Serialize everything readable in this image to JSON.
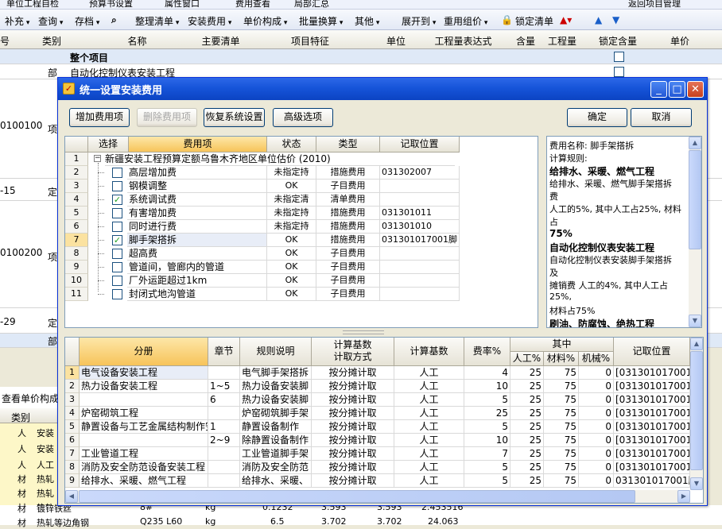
{
  "top_toolbar_1": {
    "items": [
      "单位工程自检",
      "预算书设置",
      "属性窗口",
      "费用查看",
      "局部汇总",
      "返回项目管理"
    ]
  },
  "top_toolbar_2": {
    "items": [
      "补充",
      "查询",
      "存档",
      "整理清单",
      "安装费用",
      "单价构成",
      "批量换算",
      "其他",
      "展开到",
      "重用组价",
      "锁定清单"
    ]
  },
  "bg_sheet": {
    "columns": [
      "号",
      "类别",
      "名称",
      "主要清单",
      "项目特征",
      "单位",
      "工程量表达式",
      "含量",
      "工程量",
      "锁定含量",
      "单价"
    ],
    "rows": [
      {
        "code": "",
        "type": "",
        "name": "整个项目"
      },
      {
        "code": "",
        "type": "部",
        "name": "自动化控制仪表安装工程"
      },
      {
        "code": "0100100",
        "type": "项",
        "name": ""
      },
      {
        "code": "-15",
        "type": "定",
        "name": ""
      },
      {
        "code": "0100200",
        "type": "项",
        "name": ""
      },
      {
        "code": "-29",
        "type": "定",
        "name": ""
      },
      {
        "code": "",
        "type": "部",
        "name": ""
      }
    ],
    "bottom_tab": "查看单价构成",
    "bottom_header": "类别",
    "bottom_rows": [
      {
        "type": "人",
        "name": "安装"
      },
      {
        "type": "人",
        "name": "安装"
      },
      {
        "type": "人",
        "name": "人工"
      },
      {
        "type": "材",
        "name": "热轧"
      },
      {
        "type": "材",
        "name": "热轧"
      },
      {
        "type": "材",
        "name": "热轧"
      },
      {
        "type": "材",
        "name": "镀锌铁丝"
      },
      {
        "type": "材",
        "name": "热轧等边角钢"
      }
    ],
    "bottom_extra": [
      {
        "spec": "8#",
        "unit": "kg",
        "a": "0.1232",
        "b": "3.593",
        "c": "3.593",
        "d": "2.453516"
      },
      {
        "spec": "Q235 L60",
        "unit": "kg",
        "a": "6.5",
        "b": "3.702",
        "c": "3.702",
        "d": "24.063"
      }
    ]
  },
  "dialog": {
    "title": "统一设置安装费用",
    "buttons": {
      "add_fee": "增加费用项",
      "delete_fee": "删除费用项",
      "restore": "恢复系统设置",
      "advanced": "高级选项",
      "ok": "确定",
      "cancel": "取消"
    },
    "upper_grid": {
      "headers": [
        "选择",
        "费用项",
        "状态",
        "类型",
        "记取位置"
      ],
      "rows": [
        {
          "n": "1",
          "name": "新疆安装工程预算定额乌鲁木齐地区单位估价 (2010)",
          "status": "",
          "type": "",
          "pos": "",
          "checked": null
        },
        {
          "n": "2",
          "name": "高层增加费",
          "status": "未指定持",
          "type": "措施费用",
          "pos": "031302007",
          "checked": false
        },
        {
          "n": "3",
          "name": "钢模调整",
          "status": "OK",
          "type": "子目费用",
          "pos": "",
          "checked": false
        },
        {
          "n": "4",
          "name": "系统调试费",
          "status": "未指定清",
          "type": "清单费用",
          "pos": "",
          "checked": true
        },
        {
          "n": "5",
          "name": "有害增加费",
          "status": "未指定持",
          "type": "措施费用",
          "pos": "031301011",
          "checked": false
        },
        {
          "n": "6",
          "name": "同时进行费",
          "status": "未指定持",
          "type": "措施费用",
          "pos": "031301010",
          "checked": false
        },
        {
          "n": "7",
          "name": "脚手架搭拆",
          "status": "OK",
          "type": "措施费用",
          "pos": "031301017001脚",
          "checked": true
        },
        {
          "n": "8",
          "name": "超高费",
          "status": "OK",
          "type": "子目费用",
          "pos": "",
          "checked": false
        },
        {
          "n": "9",
          "name": "管道间，管廊内的管道",
          "status": "OK",
          "type": "子目费用",
          "pos": "",
          "checked": false
        },
        {
          "n": "10",
          "name": "厂外运距超过1km",
          "status": "OK",
          "type": "子目费用",
          "pos": "",
          "checked": false
        },
        {
          "n": "11",
          "name": "封闭式地沟管道",
          "status": "OK",
          "type": "子目费用",
          "pos": "",
          "checked": false
        }
      ]
    },
    "info_lines": [
      {
        "t": "费用名称: 脚手架搭拆",
        "bold": false
      },
      {
        "t": "计算规则:",
        "bold": false
      },
      {
        "t": "给排水、采暖、燃气工程",
        "bold": true
      },
      {
        "t": "给排水、采暖、燃气脚手架搭拆",
        "bold": false
      },
      {
        "t": "费",
        "bold": false
      },
      {
        "t": "人工的5%, 其中人工占25%, 材料",
        "bold": false
      },
      {
        "t": "占",
        "bold": false
      },
      {
        "t": "75%",
        "bold": true
      },
      {
        "t": "自动化控制仪表安装工程",
        "bold": true
      },
      {
        "t": "自动化控制仪表安装脚手架搭拆",
        "bold": false
      },
      {
        "t": "及",
        "bold": false
      },
      {
        "t": "摊销费 人工的4%, 其中人工占",
        "bold": false
      },
      {
        "t": "25%,",
        "bold": false
      },
      {
        "t": "材料占75%",
        "bold": false
      },
      {
        "t": "刷油、防腐蚀、绝热工程",
        "bold": true
      }
    ],
    "lower_grid": {
      "headers": {
        "fenche": "分册",
        "zhangjie": "章节",
        "rule": "规则说明",
        "calc_base_method_1": "计算基数",
        "calc_base_method_2": "计取方式",
        "calc_base": "计算基数",
        "rate": "费率%",
        "of_which": "其中",
        "labor": "人工%",
        "material": "材料%",
        "machine": "机械%",
        "pos": "记取位置"
      },
      "rows": [
        {
          "n": "1",
          "fenche": "电气设备安装工程",
          "zj": "",
          "rule": "电气脚手架搭拆",
          "method": "按分摊计取",
          "base": "人工",
          "rate": "4",
          "labor": "25",
          "mat": "75",
          "mach": "0",
          "pos": "[031301017001脚"
        },
        {
          "n": "2",
          "fenche": "热力设备安装工程",
          "zj": "1~5",
          "rule": "热力设备安装脚",
          "method": "按分摊计取",
          "base": "人工",
          "rate": "10",
          "labor": "25",
          "mat": "75",
          "mach": "0",
          "pos": "[031301017001脚"
        },
        {
          "n": "3",
          "fenche": "",
          "zj": "6",
          "rule": "热力设备安装脚",
          "method": "按分摊计取",
          "base": "人工",
          "rate": "5",
          "labor": "25",
          "mat": "75",
          "mach": "0",
          "pos": "[031301017001脚"
        },
        {
          "n": "4",
          "fenche": "炉窑砌筑工程",
          "zj": "",
          "rule": "炉窑砌筑脚手架",
          "method": "按分摊计取",
          "base": "人工",
          "rate": "25",
          "labor": "25",
          "mat": "75",
          "mach": "0",
          "pos": "[031301017001脚"
        },
        {
          "n": "5",
          "fenche": "静置设备与工艺金属结构制作安装工程",
          "zj": "1",
          "rule": "静置设备制作",
          "method": "按分摊计取",
          "base": "人工",
          "rate": "5",
          "labor": "25",
          "mat": "75",
          "mach": "0",
          "pos": "[031301017001脚"
        },
        {
          "n": "6",
          "fenche": "",
          "zj": "2~9",
          "rule": "除静置设备制作",
          "method": "按分摊计取",
          "base": "人工",
          "rate": "10",
          "labor": "25",
          "mat": "75",
          "mach": "0",
          "pos": "[031301017001脚"
        },
        {
          "n": "7",
          "fenche": "工业管道工程",
          "zj": "",
          "rule": "工业管道脚手架",
          "method": "按分摊计取",
          "base": "人工",
          "rate": "7",
          "labor": "25",
          "mat": "75",
          "mach": "0",
          "pos": "[031301017001脚"
        },
        {
          "n": "8",
          "fenche": "消防及安全防范设备安装工程",
          "zj": "",
          "rule": "消防及安全防范",
          "method": "按分摊计取",
          "base": "人工",
          "rate": "5",
          "labor": "25",
          "mat": "75",
          "mach": "0",
          "pos": "[031301017001脚"
        },
        {
          "n": "9",
          "fenche": "给排水、采暖、燃气工程",
          "zj": "",
          "rule": "给排水、采暖、",
          "method": "按分摊计取",
          "base": "人工",
          "rate": "5",
          "labor": "25",
          "mat": "75",
          "mach": "0",
          "pos": "031301017001脚手"
        }
      ]
    }
  }
}
